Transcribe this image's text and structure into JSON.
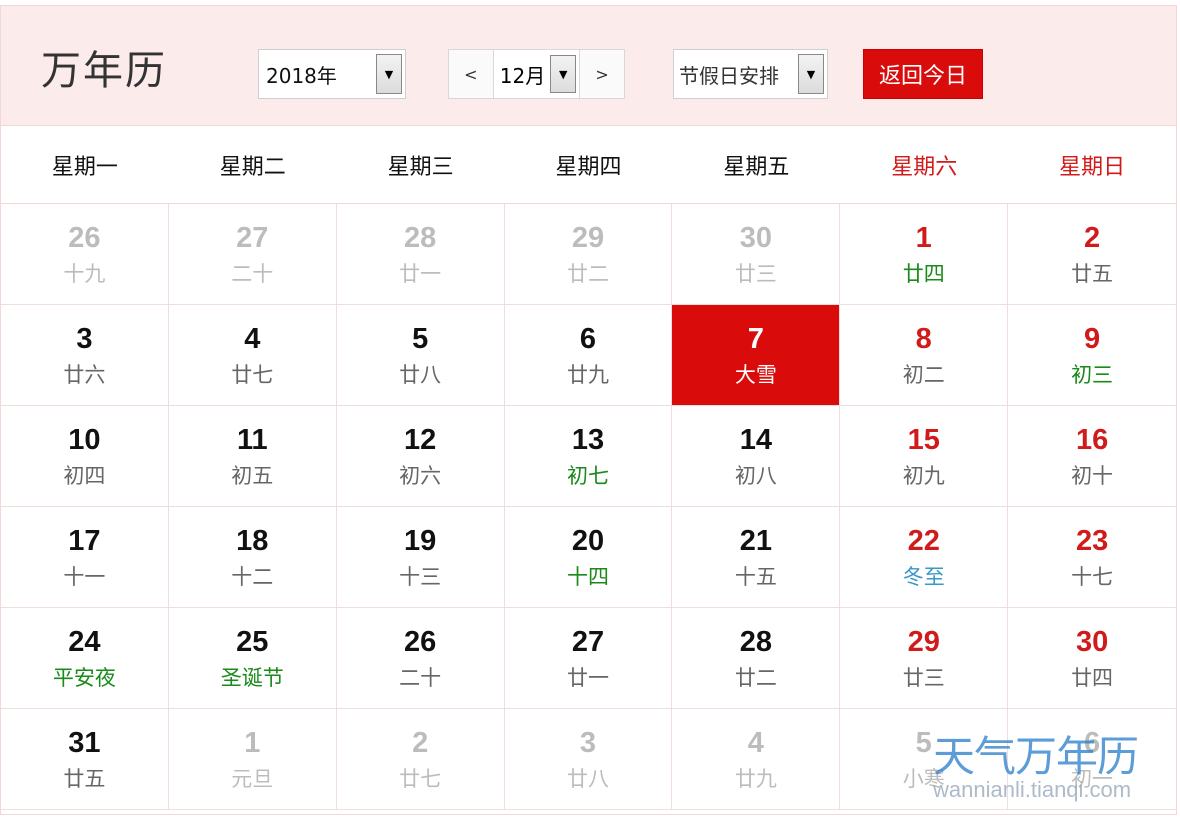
{
  "header": {
    "title": "万年历",
    "year_value": "2018年",
    "prev_label": "<",
    "month_value": "12月",
    "next_label": ">",
    "holiday_value": "节假日安排",
    "today_label": "返回今日"
  },
  "weekdays": [
    "星期一",
    "星期二",
    "星期三",
    "星期四",
    "星期五",
    "星期六",
    "星期日"
  ],
  "days": [
    {
      "day": "26",
      "lunar": "十九",
      "other": true
    },
    {
      "day": "27",
      "lunar": "二十",
      "other": true
    },
    {
      "day": "28",
      "lunar": "廿一",
      "other": true
    },
    {
      "day": "29",
      "lunar": "廿二",
      "other": true
    },
    {
      "day": "30",
      "lunar": "廿三",
      "other": true
    },
    {
      "day": "1",
      "lunar": "廿四",
      "lunar_color": "green"
    },
    {
      "day": "2",
      "lunar": "廿五"
    },
    {
      "day": "3",
      "lunar": "廿六"
    },
    {
      "day": "4",
      "lunar": "廿七"
    },
    {
      "day": "5",
      "lunar": "廿八"
    },
    {
      "day": "6",
      "lunar": "廿九"
    },
    {
      "day": "7",
      "lunar": "大雪",
      "today": true
    },
    {
      "day": "8",
      "lunar": "初二"
    },
    {
      "day": "9",
      "lunar": "初三",
      "lunar_color": "green"
    },
    {
      "day": "10",
      "lunar": "初四"
    },
    {
      "day": "11",
      "lunar": "初五"
    },
    {
      "day": "12",
      "lunar": "初六"
    },
    {
      "day": "13",
      "lunar": "初七",
      "lunar_color": "green"
    },
    {
      "day": "14",
      "lunar": "初八"
    },
    {
      "day": "15",
      "lunar": "初九"
    },
    {
      "day": "16",
      "lunar": "初十"
    },
    {
      "day": "17",
      "lunar": "十一"
    },
    {
      "day": "18",
      "lunar": "十二"
    },
    {
      "day": "19",
      "lunar": "十三"
    },
    {
      "day": "20",
      "lunar": "十四",
      "lunar_color": "green"
    },
    {
      "day": "21",
      "lunar": "十五"
    },
    {
      "day": "22",
      "lunar": "冬至",
      "lunar_color": "blue"
    },
    {
      "day": "23",
      "lunar": "十七"
    },
    {
      "day": "24",
      "lunar": "平安夜",
      "lunar_color": "green"
    },
    {
      "day": "25",
      "lunar": "圣诞节",
      "lunar_color": "green"
    },
    {
      "day": "26",
      "lunar": "二十"
    },
    {
      "day": "27",
      "lunar": "廿一"
    },
    {
      "day": "28",
      "lunar": "廿二"
    },
    {
      "day": "29",
      "lunar": "廿三"
    },
    {
      "day": "30",
      "lunar": "廿四"
    },
    {
      "day": "31",
      "lunar": "廿五"
    },
    {
      "day": "1",
      "lunar": "元旦",
      "other": true
    },
    {
      "day": "2",
      "lunar": "廿七",
      "other": true
    },
    {
      "day": "3",
      "lunar": "廿八",
      "other": true
    },
    {
      "day": "4",
      "lunar": "廿九",
      "other": true
    },
    {
      "day": "5",
      "lunar": "小寒",
      "other": true
    },
    {
      "day": "6",
      "lunar": "初一",
      "other": true
    }
  ],
  "watermark": {
    "title": "天气万年历",
    "url": "wannianli.tianqi.com"
  },
  "colors": {
    "accent": "#d90b0b",
    "weekend": "#d11a1a",
    "festival_green": "#1a8a1a",
    "solar_term_blue": "#3a98c8",
    "header_bg": "#fbeceb"
  }
}
